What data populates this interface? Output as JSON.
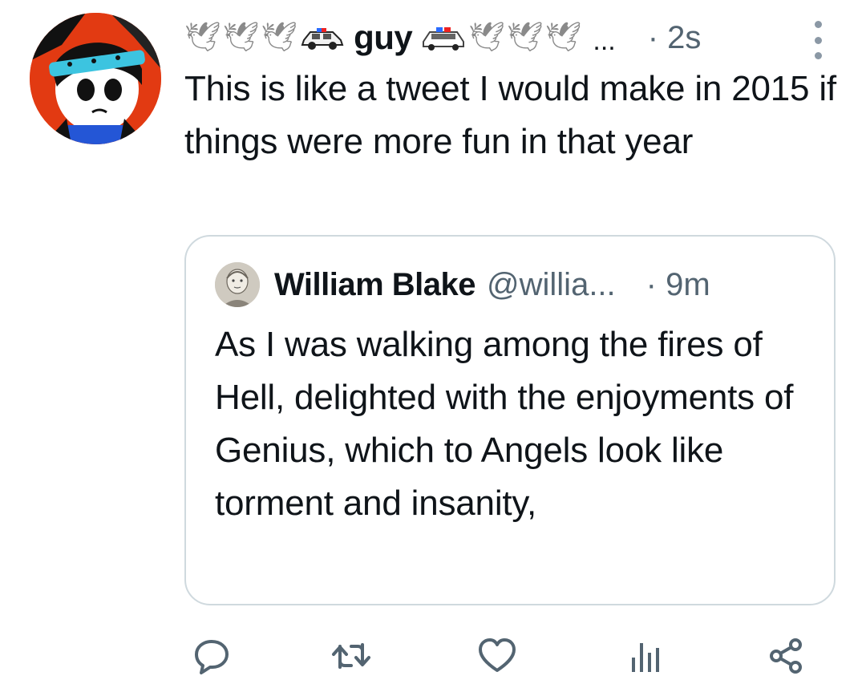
{
  "post": {
    "leading_emoji": [
      "🕊",
      "🕊",
      "🕊"
    ],
    "display_name": "guy",
    "trailing_emoji": [
      "🕊",
      "🕊",
      "🕊"
    ],
    "name_overflow": "...",
    "timestamp": "· 2s",
    "text": "This is like a tweet I would make in 2015 if things were more fun in that year"
  },
  "quote": {
    "display_name": "William Blake",
    "handle": "@willia...",
    "timestamp": "· 9m",
    "text": "As I was walking among the fires of Hell, delighted with the enjoyments of Genius, which to Angels look like torment and insanity,"
  },
  "icons": {
    "reply": "reply-icon",
    "repost": "repost-icon",
    "like": "heart-icon",
    "views": "analytics-icon",
    "share": "share-icon",
    "more": "more-options-icon",
    "police_car": "police-car-icon",
    "dove": "dove-icon"
  },
  "colors": {
    "text": "#0f1419",
    "secondary": "#536471",
    "border": "#cfd9de",
    "icon": "#536471"
  }
}
